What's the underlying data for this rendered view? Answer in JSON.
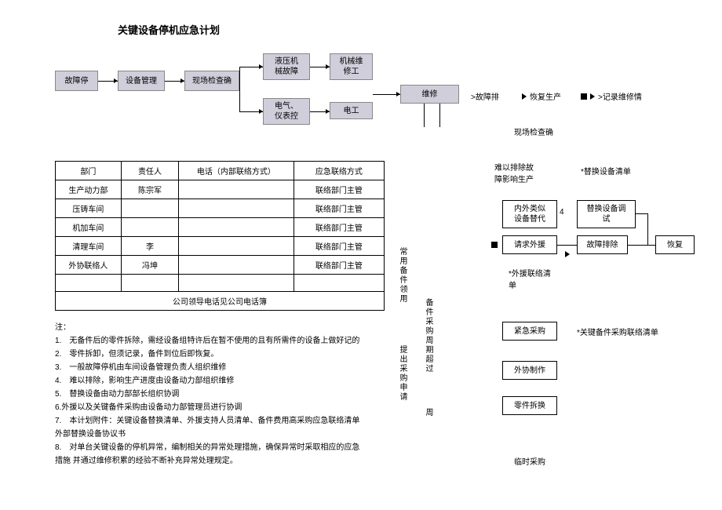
{
  "title": "关键设备停机应急计划",
  "flow": {
    "b1": "故障停",
    "b2": "设备管理",
    "b3": "现场检查确",
    "b4": "液压机\n械故障",
    "b5": "机械维\n修工",
    "b6": "电气、\n仪表控",
    "b7": "电工",
    "b8": "维修"
  },
  "legend": {
    "a": ">故障排",
    "b": "恢复生产",
    "c": ">记录维修情"
  },
  "sideText1": "现场检查确",
  "sideText2": "难以排除故\n障影响生产",
  "sideText3": "*替换设备清单",
  "table": {
    "headers": [
      "部门",
      "责任人",
      "电话（内部联络方式）",
      "应急联络方式"
    ],
    "rows": [
      [
        "生产动力部",
        "陈宗军",
        "",
        "联络部门主管"
      ],
      [
        "压铸车间",
        "",
        "",
        "联络部门主管"
      ],
      [
        "机加车间",
        "",
        "",
        "联络部门主管"
      ],
      [
        "清理车间",
        "李",
        "",
        "联络部门主管"
      ],
      [
        "外协联络人",
        "冯坤",
        "",
        "联络部门主管"
      ]
    ],
    "blankRow": [
      "",
      "",
      "",
      ""
    ],
    "footer": "公司领导电话见公司电话簿"
  },
  "notesHeader": "注：",
  "notes": [
    "1.　无备件后的零件拆除，需经设备组特许后在暂不使用的且有所需件的设备上做好记的",
    "2.　零件拆卸，但须记录，备件到位后即恢复。",
    "3.　一般故障停机由车间设备管理负责人组织维修",
    "4.　难以排除，影响生产进度由设备动力部组织维修",
    "5.　替换设备由动力部部长组织协调",
    "6.外援以及关键备件采购由设备动力部管理员进行协调",
    "7.　本计划附件：关键设备替换清单、外援支持人员清单、备件费用高采购应急联络清单",
    "外部替换设备协议书",
    "8.　对单台关键设备的停机异常，编制相关的异常处理措施，确保异常时采取相应的应急",
    "措施 并通过维修积累的经验不断补充异常处理规定。"
  ],
  "vcol1": "常用备件领用",
  "vcol2": "提出采购申请",
  "vcol3": "备件采购周期超过",
  "vcol4": "周",
  "rboxes": {
    "a": "内外类似\n设备替代",
    "aNum": "4",
    "b": "替换设备调\n试",
    "c": "请求外援",
    "d": "故障排除",
    "e": "恢复",
    "f": "紧急采购",
    "g": "外协制作",
    "h": "零件拆换"
  },
  "rlabels": {
    "a": "*外援联络清\n单",
    "b": "*关键备件采购联络清单",
    "c": "临时采购"
  }
}
